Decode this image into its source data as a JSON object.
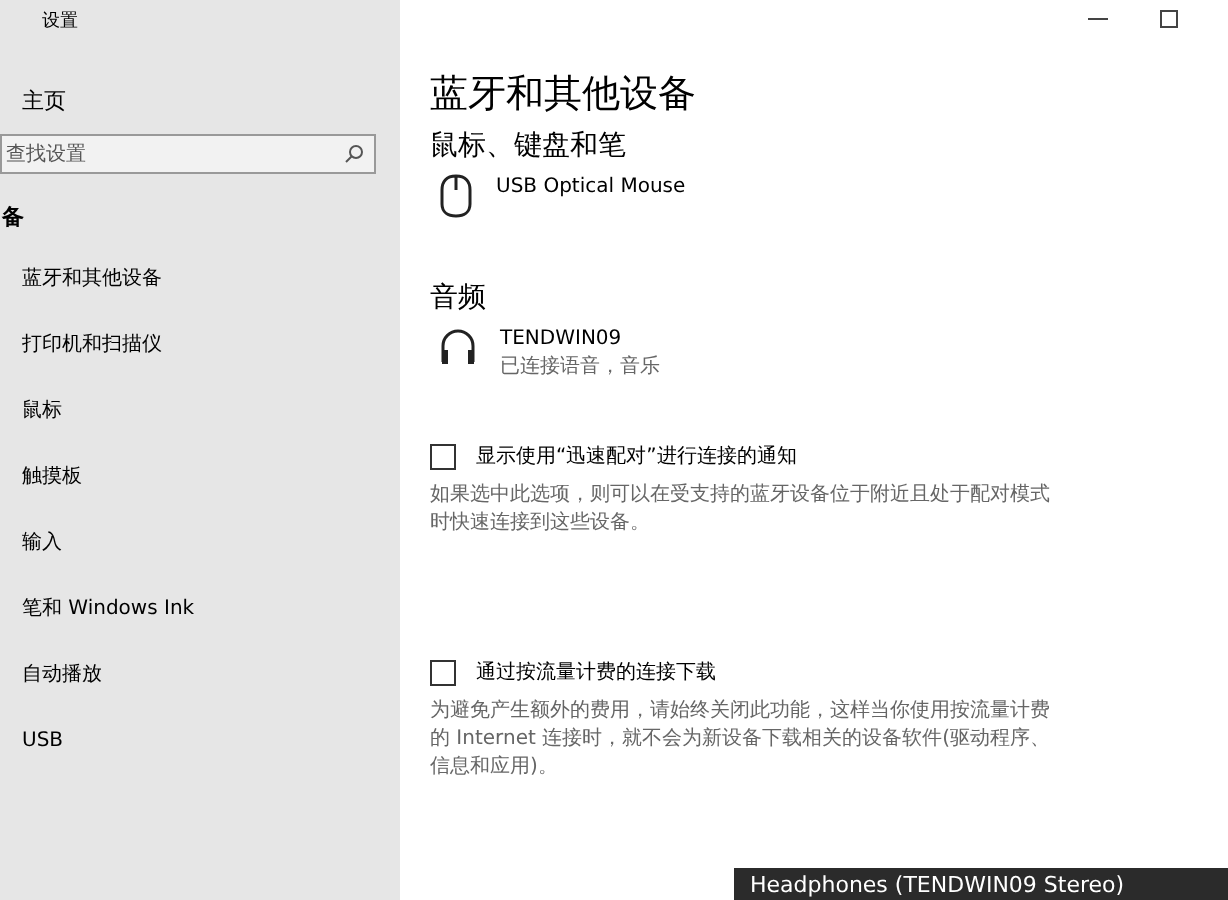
{
  "window": {
    "title": "设置"
  },
  "sidebar": {
    "home": "主页",
    "search": {
      "placeholder": "查找设置"
    },
    "section": "备",
    "items": [
      {
        "label": "蓝牙和其他设备"
      },
      {
        "label": "打印机和扫描仪"
      },
      {
        "label": "鼠标"
      },
      {
        "label": "触摸板"
      },
      {
        "label": "输入"
      },
      {
        "label": "笔和 Windows Ink"
      },
      {
        "label": "自动播放"
      },
      {
        "label": "USB"
      }
    ]
  },
  "main": {
    "title": "蓝牙和其他设备",
    "groups": [
      {
        "heading": "鼠标、键盘和笔",
        "devices": [
          {
            "kind": "mouse",
            "name": "USB Optical Mouse"
          }
        ]
      },
      {
        "heading": "音频",
        "devices": [
          {
            "kind": "headphones",
            "name": "TENDWIN09",
            "status": "已连接语音，音乐"
          }
        ]
      }
    ],
    "options": [
      {
        "label": "显示使用“迅速配对”进行连接的通知",
        "checked": false,
        "description": "如果选中此选项，则可以在受支持的蓝牙设备位于附近且处于配对模式时快速连接到这些设备。"
      },
      {
        "label": "通过按流量计费的连接下载",
        "checked": false,
        "description": "为避免产生额外的费用，请始终关闭此功能，这样当你使用按流量计费的 Internet 连接时，就不会为新设备下载相关的设备软件(驱动程序、信息和应用)。"
      }
    ]
  },
  "notification": {
    "text": "Headphones (TENDWIN09 Stereo)"
  }
}
